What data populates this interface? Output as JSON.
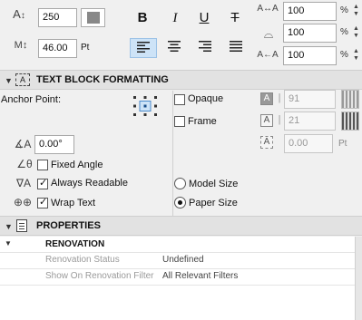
{
  "top": {
    "font_size": "250",
    "leading": "46.00",
    "leading_unit": "Pt",
    "width_pct": "100",
    "slant_pct": "100",
    "spacing_pct": "100",
    "pct_symbol": "%",
    "style_buttons": [
      "B",
      "I",
      "U",
      "T"
    ],
    "align_buttons": [
      "left",
      "center",
      "right",
      "justify"
    ]
  },
  "text_block": {
    "title": "TEXT BLOCK FORMATTING",
    "anchor_label": "Anchor Point:",
    "opaque_label": "Opaque",
    "opaque_checked": false,
    "opaque_value": "91",
    "frame_label": "Frame",
    "frame_checked": false,
    "frame_value": "21",
    "frame_offset": "0.00",
    "frame_offset_unit": "Pt",
    "angle_value": "0.00°",
    "fixed_angle_label": "Fixed Angle",
    "fixed_angle_checked": false,
    "always_readable_label": "Always Readable",
    "always_readable_checked": true,
    "wrap_text_label": "Wrap Text",
    "wrap_text_checked": true,
    "model_size_label": "Model Size",
    "paper_size_label": "Paper Size",
    "size_mode": "paper"
  },
  "properties": {
    "title": "PROPERTIES",
    "group": "RENOVATION",
    "rows": [
      {
        "key": "Renovation Status",
        "value": "Undefined"
      },
      {
        "key": "Show On Renovation Filter",
        "value": "All Relevant Filters"
      }
    ]
  },
  "colors": {
    "selected_bg": "#cde3f7",
    "header_bg": "#e2e2e2"
  }
}
